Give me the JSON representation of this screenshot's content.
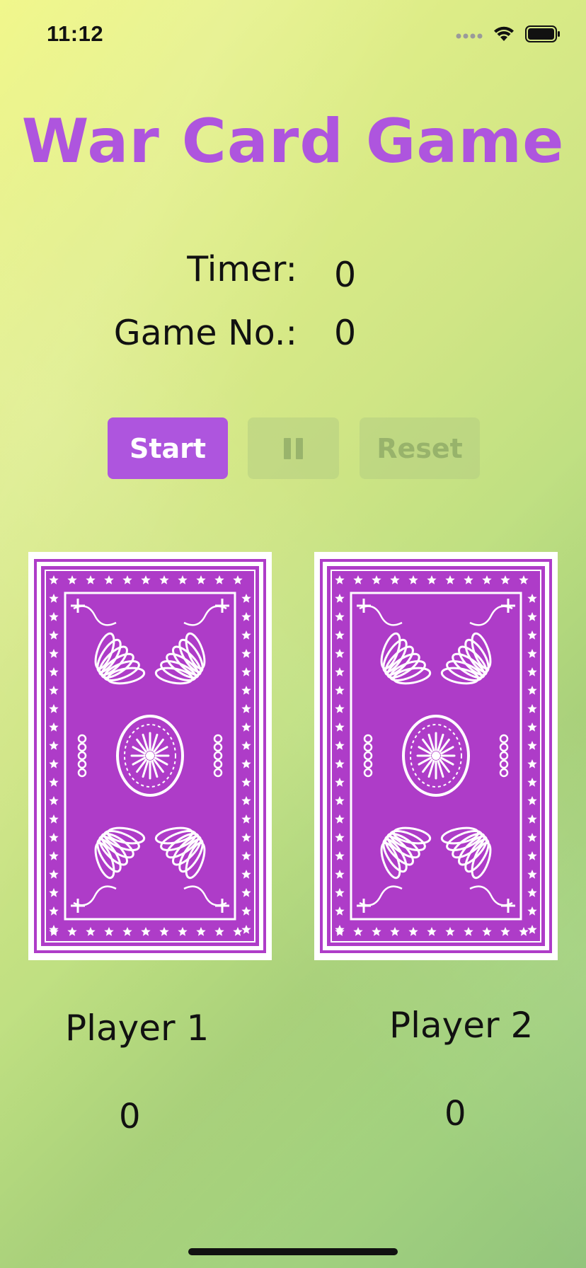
{
  "status_bar": {
    "time": "11:12",
    "icons": [
      "signal-dots-icon",
      "wifi-icon",
      "battery-icon"
    ]
  },
  "title": "War Card Game",
  "stats": {
    "timer_label": "Timer:",
    "timer_value": "0",
    "game_label": "Game No.:",
    "game_value": "0"
  },
  "controls": {
    "start_label": "Start",
    "pause_icon": "pause-icon",
    "reset_label": "Reset",
    "pause_enabled": false,
    "reset_enabled": false
  },
  "cards": {
    "left": {
      "face": "card-back",
      "color": "#ae3cc8"
    },
    "right": {
      "face": "card-back",
      "color": "#ae3cc8"
    }
  },
  "players": [
    {
      "name": "Player 1",
      "score": "0"
    },
    {
      "name": "Player 2",
      "score": "0"
    }
  ],
  "colors": {
    "accent": "#ae55de",
    "card_pattern": "#ae3cc8",
    "disabled_button": "#b4cd82"
  }
}
